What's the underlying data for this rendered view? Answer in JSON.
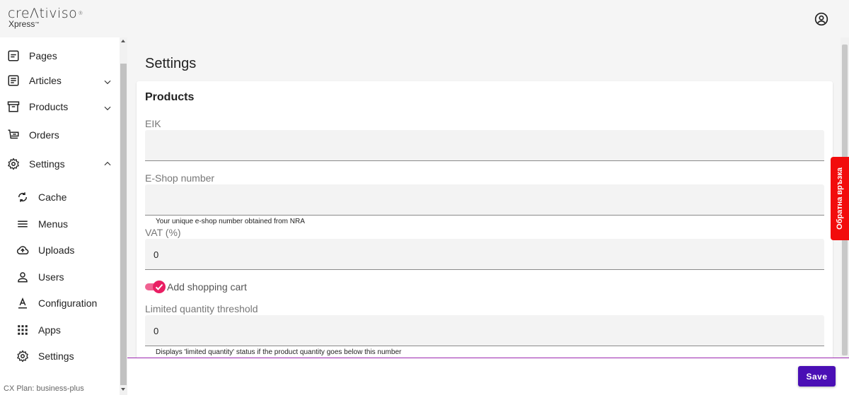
{
  "header": {
    "brand": "creΛtiviso",
    "brand_mark": "®",
    "sub": "Xpress",
    "sub_mark": "™"
  },
  "sidebar": {
    "items": [
      {
        "label": "Pages",
        "icon": "pages-icon"
      },
      {
        "label": "Articles",
        "icon": "articles-icon",
        "expandable": true
      },
      {
        "label": "Products",
        "icon": "archive-icon",
        "expandable": true
      },
      {
        "label": "Orders",
        "icon": "orders-icon"
      },
      {
        "label": "Settings",
        "icon": "gear-icon",
        "expanded": true
      }
    ],
    "settings_children": [
      {
        "label": "Cache",
        "icon": "refresh-icon"
      },
      {
        "label": "Menus",
        "icon": "menu-icon"
      },
      {
        "label": "Uploads",
        "icon": "cloud-upload-icon"
      },
      {
        "label": "Users",
        "icon": "person-icon"
      },
      {
        "label": "Configuration",
        "icon": "font-icon"
      },
      {
        "label": "Apps",
        "icon": "apps-icon"
      },
      {
        "label": "Settings",
        "icon": "gear-icon"
      }
    ],
    "plan": "CX Plan: business-plus"
  },
  "main": {
    "title": "Settings",
    "card": {
      "title": "Products",
      "eik": {
        "label": "EIK",
        "value": ""
      },
      "eshop": {
        "label": "E-Shop number",
        "value": "",
        "hint": "Your unique e-shop number obtained from NRA"
      },
      "vat": {
        "label": "VAT (%)",
        "value": "0"
      },
      "cart": {
        "label": "Add shopping cart",
        "checked": true
      },
      "threshold": {
        "label": "Limited quantity threshold",
        "value": "0",
        "hint": "Displays 'limited quantity' status if the product quantity goes below this number"
      }
    }
  },
  "footer": {
    "save_label": "Save"
  },
  "feedback": {
    "label": "Обратна връзка"
  },
  "colors": {
    "accent": "#4a0fb5",
    "toggle": "#e91e63",
    "feedback": "#f20c0c"
  }
}
